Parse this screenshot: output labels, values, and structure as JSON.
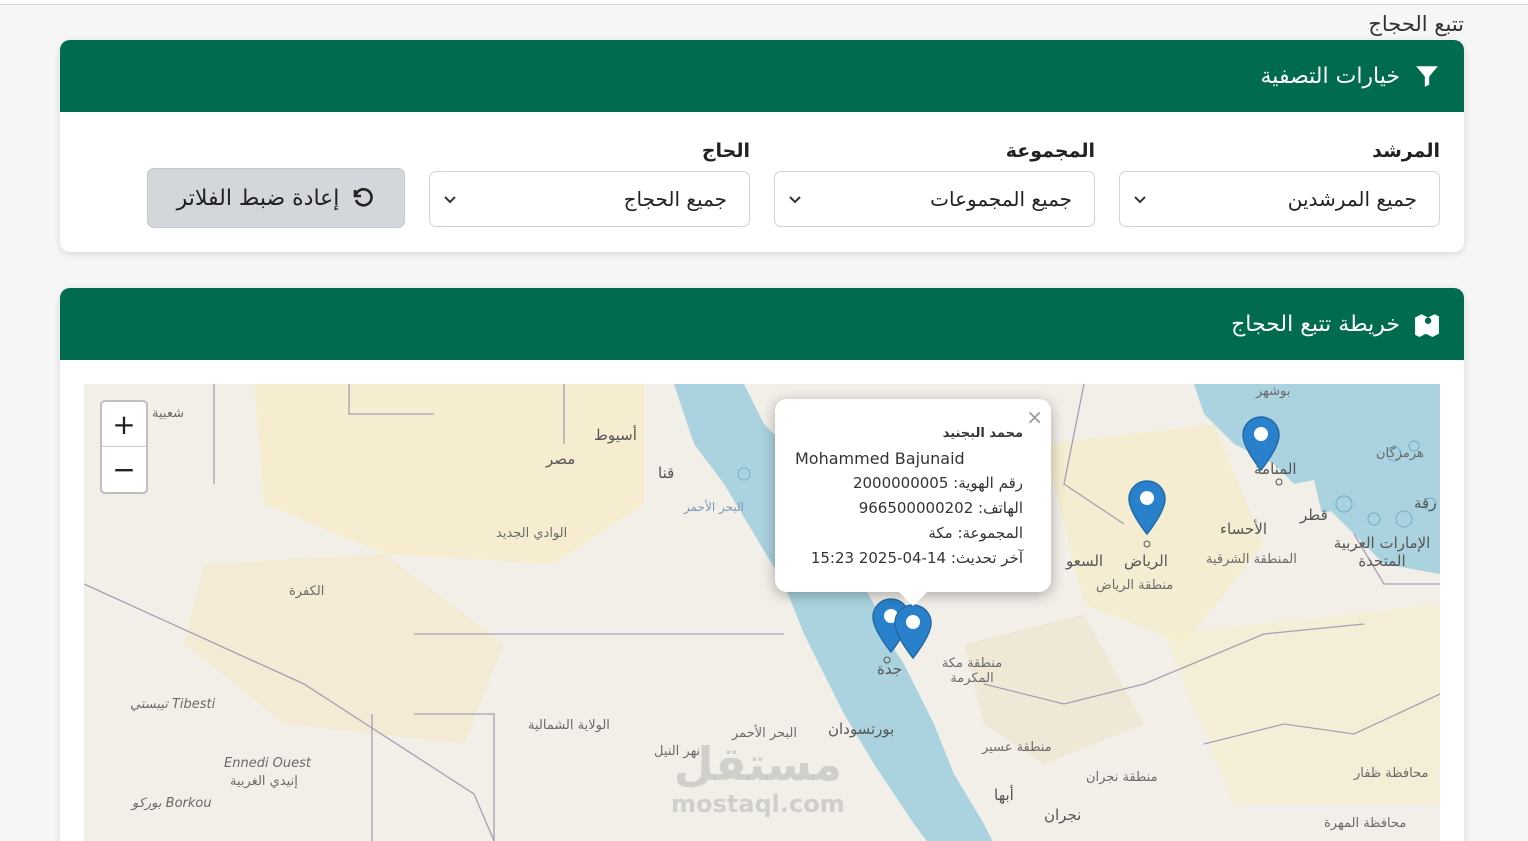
{
  "page_title": "تتبع الحجاج",
  "filters": {
    "header": "خيارات التصفية",
    "guide_label": "المرشد",
    "guide_value": "جميع المرشدين",
    "group_label": "المجموعة",
    "group_value": "جميع المجموعات",
    "pilgrim_label": "الحاج",
    "pilgrim_value": "جميع الحجاج",
    "reset_label": "إعادة ضبط الفلاتر"
  },
  "map_card": {
    "header": "خريطة تتبع الحجاج",
    "zoom_in": "+",
    "zoom_out": "−"
  },
  "popup": {
    "close": "×",
    "name_ar": "محمد البجنيد",
    "name_en": "Mohammed Bajunaid",
    "id_line": "رقم الهوية: 2000000005",
    "phone_line": "الهاتف: 966500000202",
    "group_line": "المجموعة: مكة",
    "updated_line": "آخر تحديث: 14-04-2025 15:23"
  },
  "map_labels": {
    "shabia": "شعبية",
    "asyut": "أسيوط",
    "misr": "مصر",
    "qena": "قنا",
    "red_sea_north": "البحر الأحمر",
    "wadi_jadid": "الوادي الجديد",
    "kufra": "الكفرة",
    "tibesti": "Tibesti تيبستي",
    "northern_state": "الولاية الشمالية",
    "red_sea_south": "البحر الأحمر",
    "nile": "نهر النيل",
    "port_sudan": "بورتسودان",
    "ennedi": "Ennedi Ouest",
    "ennedi_ar": "إنيدي الغربية",
    "borkou": "Borkou بوركو",
    "jeddah": "جدة",
    "makkah_region": "منطقة مكة المكرمة",
    "asir": "منطقة عسير",
    "abha": "أبها",
    "najran_region": "منطقة نجران",
    "najran": "نجران",
    "riyadh": "الرياض",
    "riyadh_region": "منطقة الرياض",
    "saudi": "السعو",
    "bushehr": "بوشهر",
    "manama": "المنامة",
    "hormozgan": "هرمزگان",
    "ahsa": "الأحساء",
    "qatar": "قطر",
    "eastern_region": "المنطقة الشرقية",
    "uae": "الإمارات العربية المتحدة",
    "dhofar": "محافظة ظفار",
    "mahra": "محافظة المهرة",
    "iraq_frag": "رقة",
    "watermark_ar": "مستقل",
    "watermark_en": "mostaql.com"
  }
}
